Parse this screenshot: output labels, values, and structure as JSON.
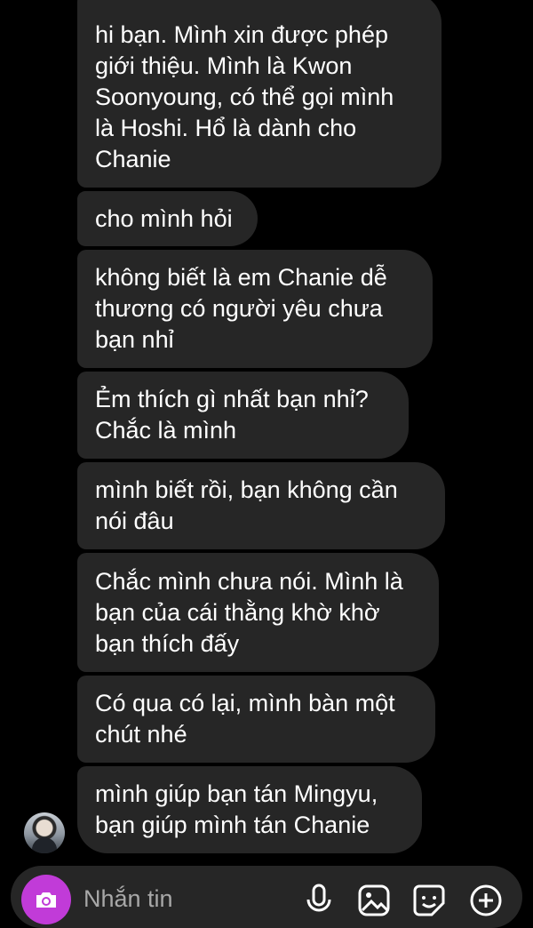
{
  "messages": [
    "hi bạn. Mình xin được phép\ngiới thiệu. Mình là Kwon\nSoonyoung, có thể gọi mình\nlà Hoshi. Hổ là dành cho\nChanie",
    "cho mình hỏi",
    "không biết là em Chanie dễ\nthương có người yêu chưa\nbạn nhỉ",
    "Ẻm thích gì nhất bạn nhỉ?\nChắc là mình",
    "mình biết rồi, bạn không cần\nnói đâu",
    "Chắc mình chưa nói. Mình là\nbạn của cái thằng khờ khờ\nbạn thích đấy",
    "Có qua có lại, mình bàn một\nchút nhé",
    "mình giúp bạn tán Mingyu,\nbạn giúp mình tán Chanie"
  ],
  "composer": {
    "placeholder": "Nhắn tin",
    "icons": [
      "camera-icon",
      "microphone-icon",
      "gallery-icon",
      "sticker-icon",
      "add-icon"
    ]
  },
  "colors": {
    "background": "#000000",
    "bubble": "#262626",
    "text": "#ffffff",
    "accent": "#c13bd8",
    "placeholder": "#a8a8a8"
  }
}
